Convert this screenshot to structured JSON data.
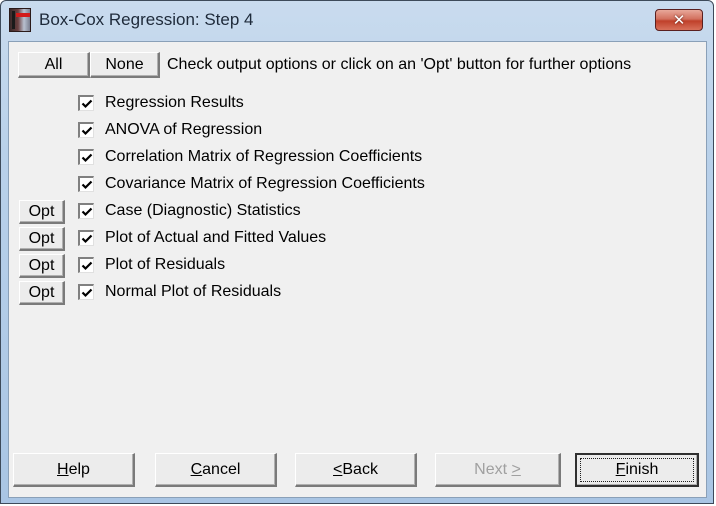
{
  "window": {
    "title": "Box-Cox Regression: Step 4",
    "close_glyph": "✕",
    "colors": {
      "close_button": "#c9503a",
      "client_bg": "#f0f0f0",
      "disabled_text": "#a0a0a0"
    }
  },
  "toolbar": {
    "all_label": "All",
    "none_label": "None",
    "instruction": "Check output options or click on an 'Opt' button for further options"
  },
  "options": [
    {
      "label": "Regression Results",
      "checked": true,
      "has_opt": false
    },
    {
      "label": "ANOVA of Regression",
      "checked": true,
      "has_opt": false
    },
    {
      "label": "Correlation Matrix of Regression Coefficients",
      "checked": true,
      "has_opt": false
    },
    {
      "label": "Covariance Matrix of Regression Coefficients",
      "checked": true,
      "has_opt": false
    },
    {
      "label": "Case (Diagnostic) Statistics",
      "checked": true,
      "has_opt": true
    },
    {
      "label": "Plot of Actual and Fitted Values",
      "checked": true,
      "has_opt": true
    },
    {
      "label": "Plot of Residuals",
      "checked": true,
      "has_opt": true
    },
    {
      "label": "Normal Plot of Residuals",
      "checked": true,
      "has_opt": true
    }
  ],
  "opt_label": "Opt",
  "footer": {
    "help": {
      "mnemonic": "H",
      "rest": "elp"
    },
    "cancel": {
      "mnemonic": "C",
      "rest": "ancel"
    },
    "back": {
      "pre": "",
      "mnemonic": "<",
      "rest": " Back"
    },
    "next": {
      "pre": "Next ",
      "mnemonic": ">",
      "rest": "",
      "disabled": true
    },
    "finish": {
      "mnemonic": "F",
      "rest": "inish",
      "default": true
    }
  }
}
